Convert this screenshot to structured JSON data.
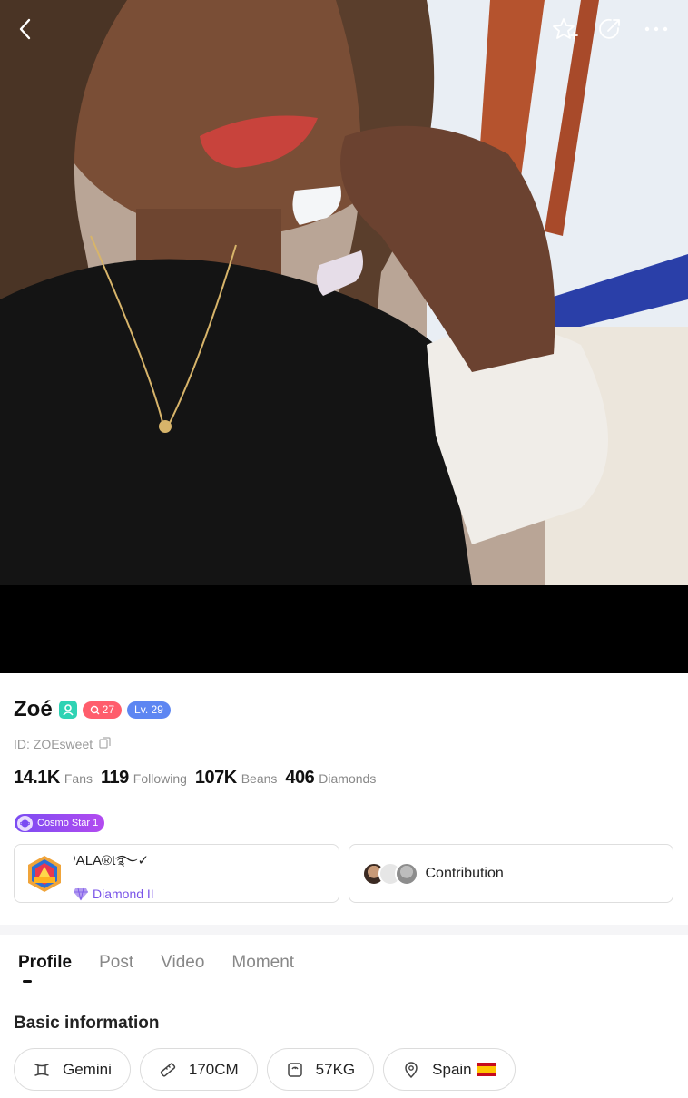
{
  "profile": {
    "name": "Zoé",
    "fan_level": "27",
    "user_level": "Lv. 29",
    "id_text": "ID: ZOEsweet"
  },
  "stats": [
    {
      "value": "14.1K",
      "label": "Fans"
    },
    {
      "value": "119",
      "label": "Following"
    },
    {
      "value": "107K",
      "label": "Beans"
    },
    {
      "value": "406",
      "label": "Diamonds"
    }
  ],
  "badge": {
    "label": "Cosmo Star 1"
  },
  "agency": {
    "name": "⁾ALA®t࿐✓",
    "rank": "Diamond II"
  },
  "contribution": {
    "label": "Contribution"
  },
  "tabs": [
    {
      "label": "Profile",
      "active": true
    },
    {
      "label": "Post",
      "active": false
    },
    {
      "label": "Video",
      "active": false
    },
    {
      "label": "Moment",
      "active": false
    }
  ],
  "basic_info": {
    "title": "Basic information",
    "zodiac": "Gemini",
    "height": "170CM",
    "weight": "57KG",
    "country": "Spain"
  },
  "colors": {
    "accent_purple": "#7a54e8",
    "verified_teal": "#2fd3b4",
    "fan_pill_red": "#ff5d6c",
    "level_pill_blue": "#5d86f2"
  },
  "icons": {
    "back": "chevron-left-icon",
    "favorite": "star-plus-icon",
    "share": "share-icon",
    "more": "more-dots-icon"
  }
}
